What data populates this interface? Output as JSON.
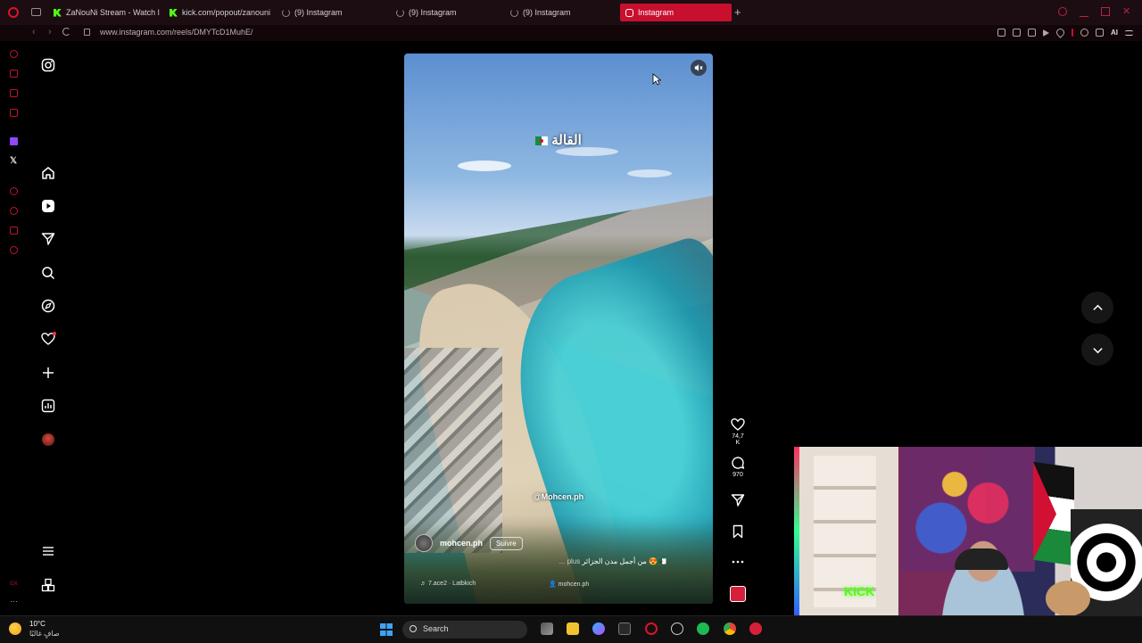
{
  "browser": {
    "tabs": [
      {
        "label": "ZaNouNi Stream - Watch l",
        "favicon": "kick-icon",
        "active": false
      },
      {
        "label": "kick.com/popout/zanouni",
        "favicon": "kick-icon",
        "active": false
      },
      {
        "label": "(9) Instagram",
        "favicon": "loading-icon",
        "active": false
      },
      {
        "label": "(9) Instagram",
        "favicon": "loading-icon",
        "active": false
      },
      {
        "label": "(9) Instagram",
        "favicon": "loading-icon",
        "active": false
      },
      {
        "label": "Instagram",
        "favicon": "instagram-icon",
        "active": true
      }
    ],
    "new_tab": "+",
    "url": "www.instagram.com/reels/DMYTcD1MuhE/",
    "ai_label": "AI",
    "accent": "#c8102e"
  },
  "reel": {
    "overlay_title": "القالة",
    "watermark": "@Mohcen.ph",
    "author": "mohcen.ph",
    "follow_label": "Suivre",
    "caption": "من أجمل مدن الجزائر 😍🇩🇿",
    "caption_more": "... plus",
    "audio": "♬ 7.ace2 · Latbkich",
    "tagged_user": "mohcen.ph"
  },
  "actions": {
    "likes": "74,7 K",
    "comments": "970"
  },
  "taskbar": {
    "temperature": "10°C",
    "weather": "صافٍ غالبًا",
    "search_label": "Search"
  }
}
